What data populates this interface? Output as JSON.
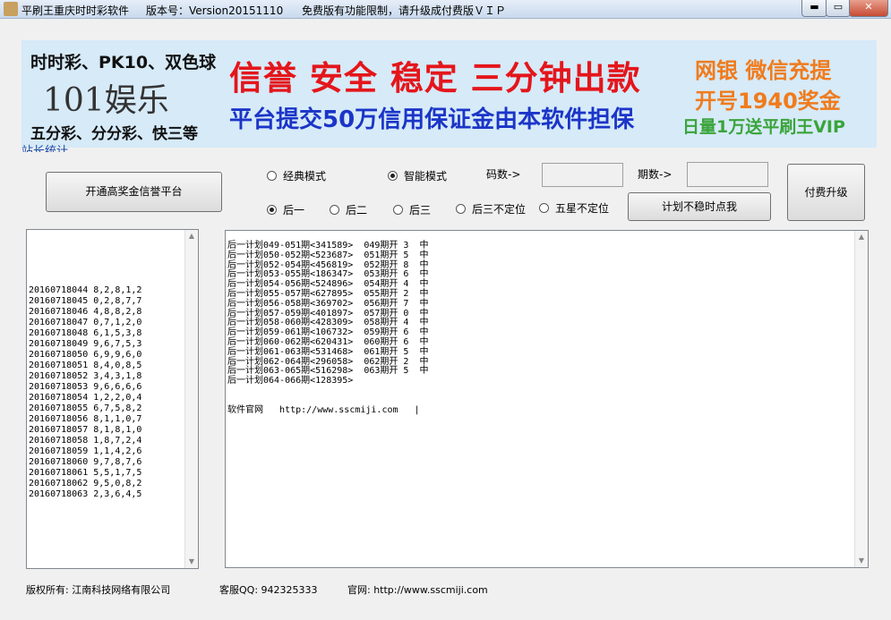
{
  "titlebar": {
    "app_title": "平刷王重庆时时彩软件",
    "version": "版本号：Version20151110",
    "notice": "免费版有功能限制，请升级成付费版ＶＩＰ",
    "minimize": "▬",
    "maximize": "▭",
    "close": "✕"
  },
  "banner": {
    "left_line1": "时时彩、PK10、双色球",
    "left_line2": "101娱乐",
    "left_line3": "五分彩、分分彩、快三等",
    "center_line1": "信誉 安全 稳定 三分钟出款",
    "center_line2": "平台提交50万信用保证金由本软件担保",
    "right_line1": "网银 微信充提",
    "right_line2": "开号1940奖金",
    "right_line3": "日量1万送平刷王VIP"
  },
  "stat_link": "站长统计",
  "buttons": {
    "open_platform": "开通高奖金信誉平台",
    "plan_unstable": "计划不稳时点我",
    "upgrade": "付费升级"
  },
  "modes": {
    "classic": "经典模式",
    "smart": "智能模式",
    "selected": "smart"
  },
  "fields": {
    "code_count_label": "码数->",
    "code_count_value": "",
    "period_count_label": "期数->",
    "period_count_value": ""
  },
  "positions": {
    "options": [
      "后一",
      "后二",
      "后三",
      "后三不定位",
      "五星不定位"
    ],
    "selected": "后一"
  },
  "history": [
    "20160718044 8,2,8,1,2",
    "20160718045 0,2,8,7,7",
    "20160718046 4,8,8,2,8",
    "20160718047 0,7,1,2,0",
    "20160718048 6,1,5,3,8",
    "20160718049 9,6,7,5,3",
    "20160718050 6,9,9,6,0",
    "20160718051 8,4,0,8,5",
    "20160718052 3,4,3,1,8",
    "20160718053 9,6,6,6,6",
    "20160718054 1,2,2,0,4",
    "20160718055 6,7,5,8,2",
    "20160718056 8,1,1,0,7",
    "20160718057 8,1,8,1,0",
    "20160718058 1,8,7,2,4",
    "20160718059 1,1,4,2,6",
    "20160718060 9,7,8,7,6",
    "20160718061 5,5,1,7,5",
    "20160718062 9,5,0,8,2",
    "20160718063 2,3,6,4,5"
  ],
  "plans": [
    "后一计划049-051期<341589>  049期开 3  中",
    "后一计划050-052期<523687>  051期开 5  中",
    "后一计划052-054期<456819>  052期开 8  中",
    "后一计划053-055期<186347>  053期开 6  中",
    "后一计划054-056期<524896>  054期开 4  中",
    "后一计划055-057期<627895>  055期开 2  中",
    "后一计划056-058期<369702>  056期开 7  中",
    "后一计划057-059期<401897>  057期开 0  中",
    "后一计划058-060期<428309>  058期开 4  中",
    "后一计划059-061期<106732>  059期开 6  中",
    "后一计划060-062期<620431>  060期开 6  中",
    "后一计划061-063期<531468>  061期开 5  中",
    "后一计划062-064期<296058>  062期开 2  中",
    "后一计划063-065期<516298>  063期开 5  中",
    "后一计划064-066期<128395>"
  ],
  "official_site_line": "软件官网   http://www.sscmiji.com   |",
  "footer": {
    "copyright": "版权所有: 江南科技网络有限公司",
    "qq": "客服QQ: 942325333",
    "site": "官网: http://www.sscmiji.com"
  }
}
